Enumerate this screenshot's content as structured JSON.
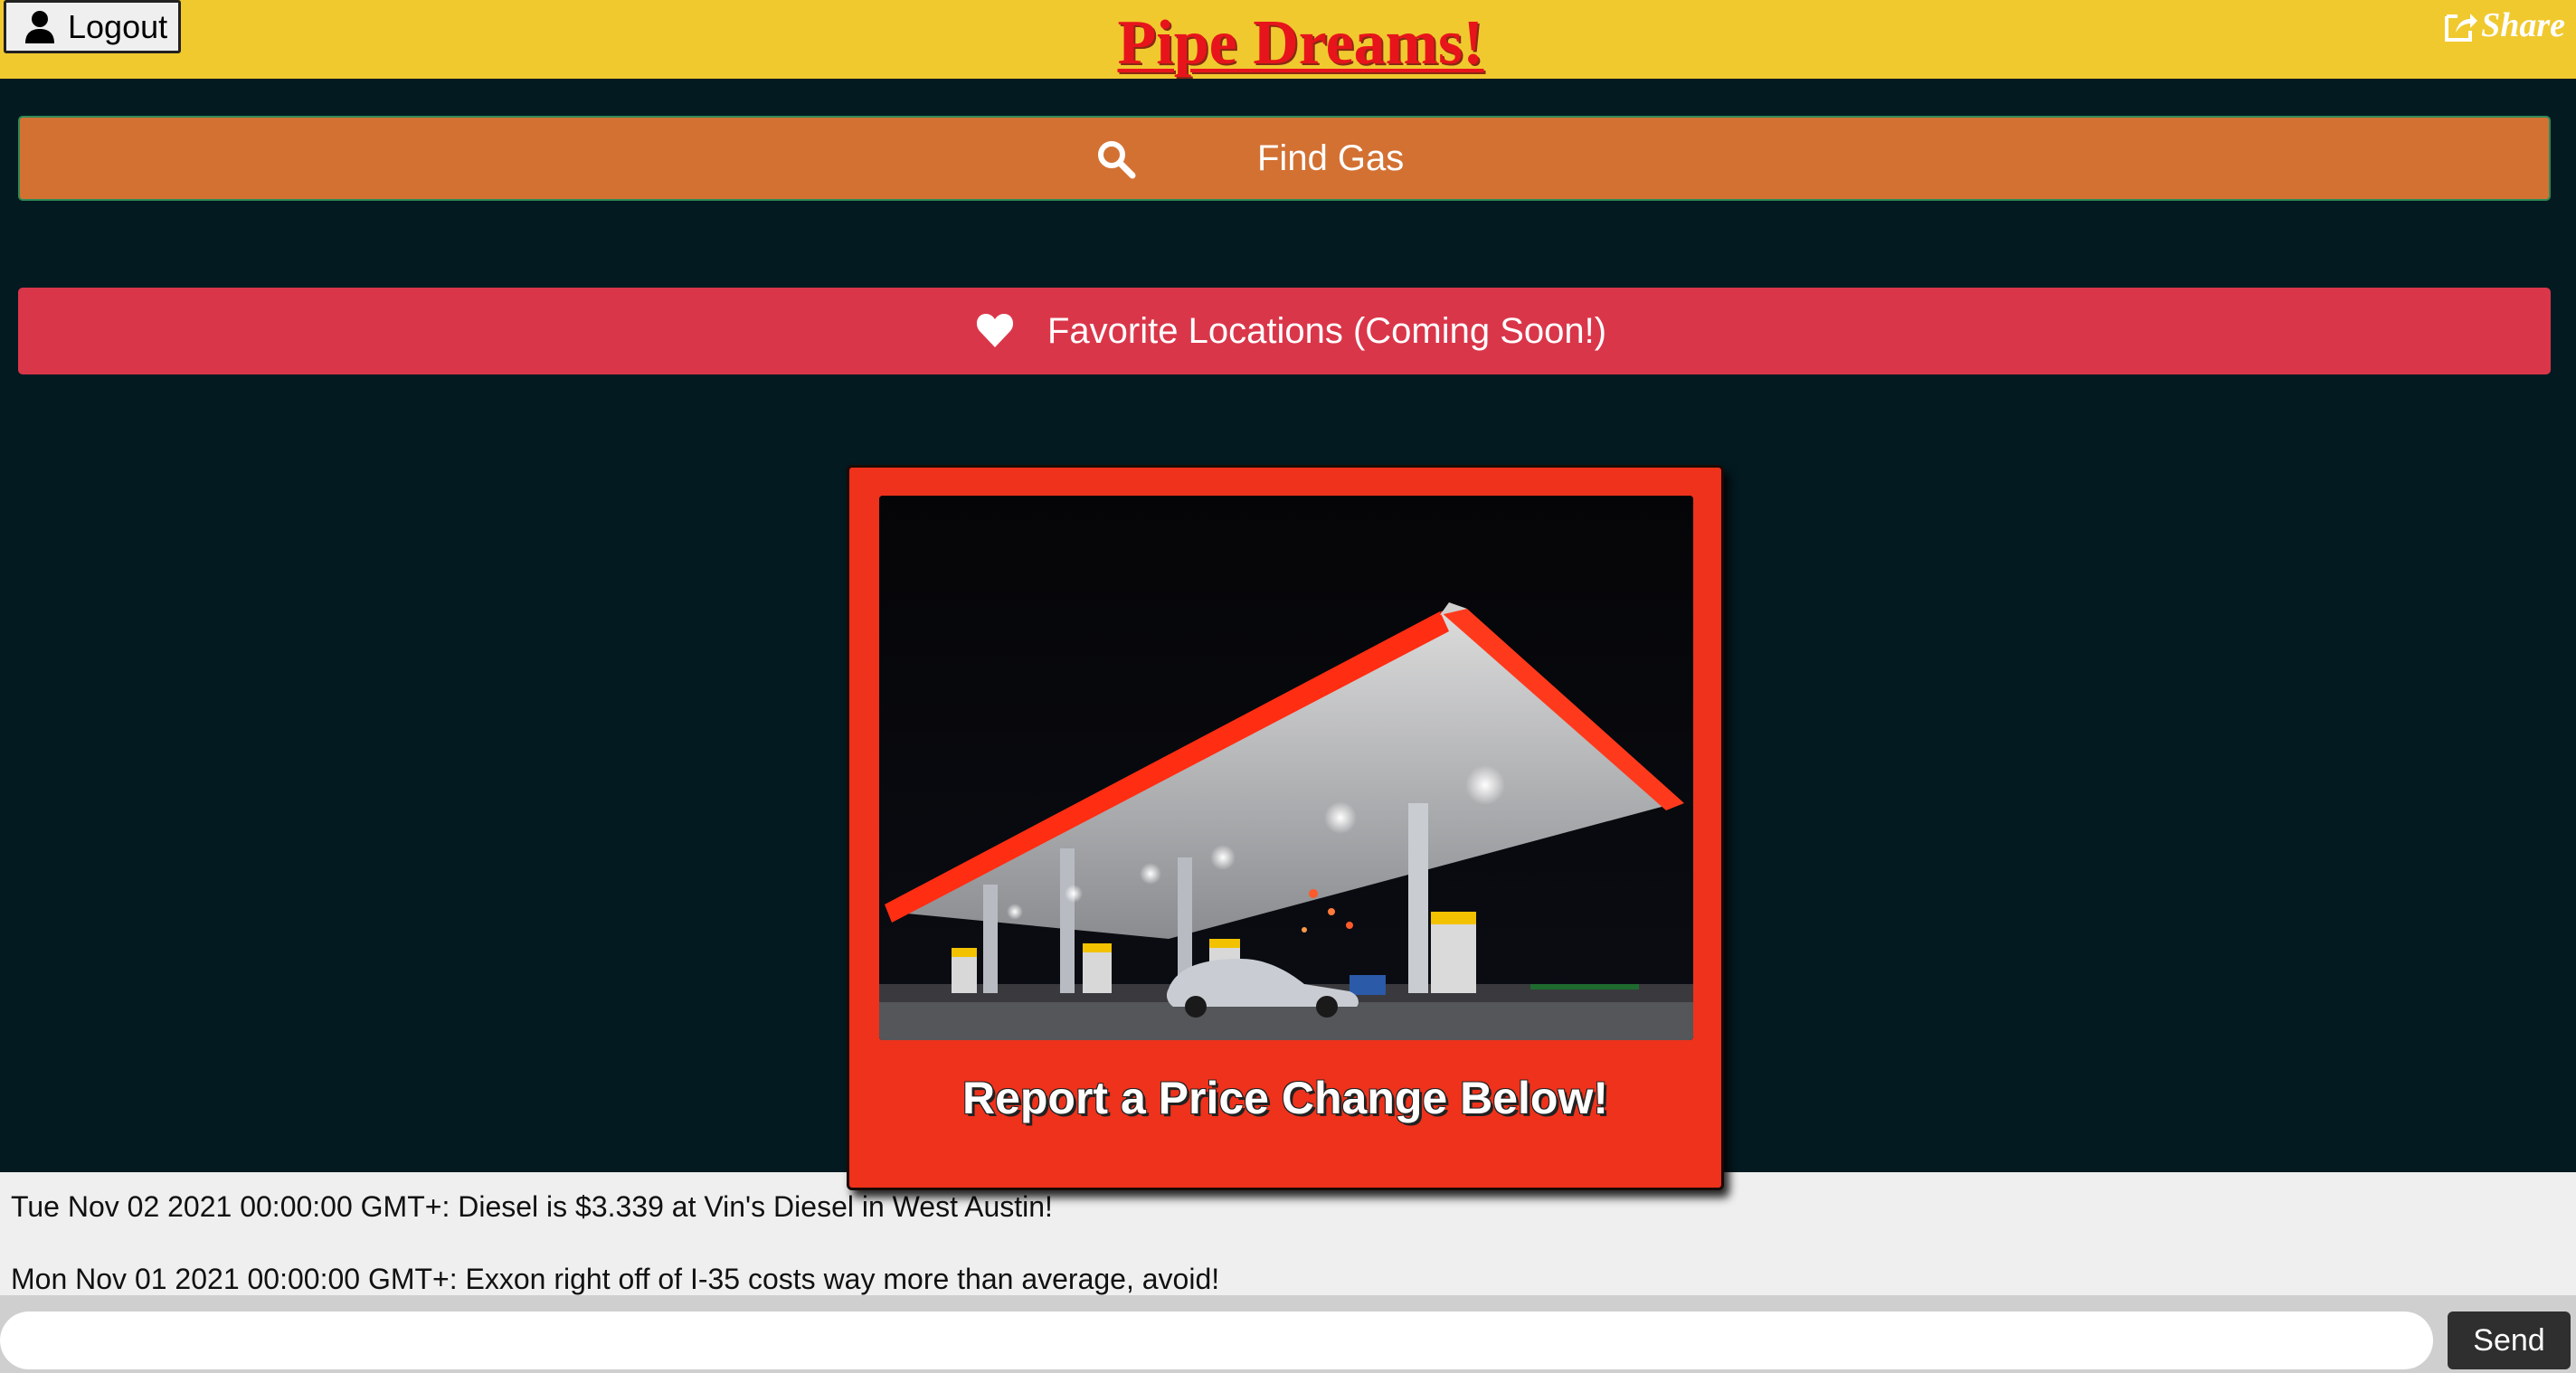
{
  "header": {
    "title": "Pipe Dreams!",
    "logout_label": "Logout",
    "share_label": "Share",
    "background_color": "#f0c92f"
  },
  "actions": {
    "find_gas_label": "Find Gas",
    "find_gas_color": "#d37133",
    "favorites_label": "Favorite Locations (Coming Soon!)",
    "favorites_color": "#da364a"
  },
  "report_card": {
    "caption": "Report a Price Change Below!",
    "color": "#ee321c",
    "image_subject": "gas station at night"
  },
  "messages": [
    {
      "text": "Tue Nov 02 2021 00:00:00 GMT+: Diesel is $3.339 at Vin's Diesel in West Austin!"
    },
    {
      "text": "Mon Nov 01 2021 00:00:00 GMT+: Exxon right off of I-35 costs way more than average, avoid!"
    }
  ],
  "composer": {
    "input_value": "",
    "input_placeholder": "",
    "send_label": "Send"
  },
  "icons": {
    "logout": "user-icon",
    "share": "share-icon",
    "find_gas": "search-icon",
    "favorites": "heart-icon"
  },
  "page_background": "#031a21"
}
